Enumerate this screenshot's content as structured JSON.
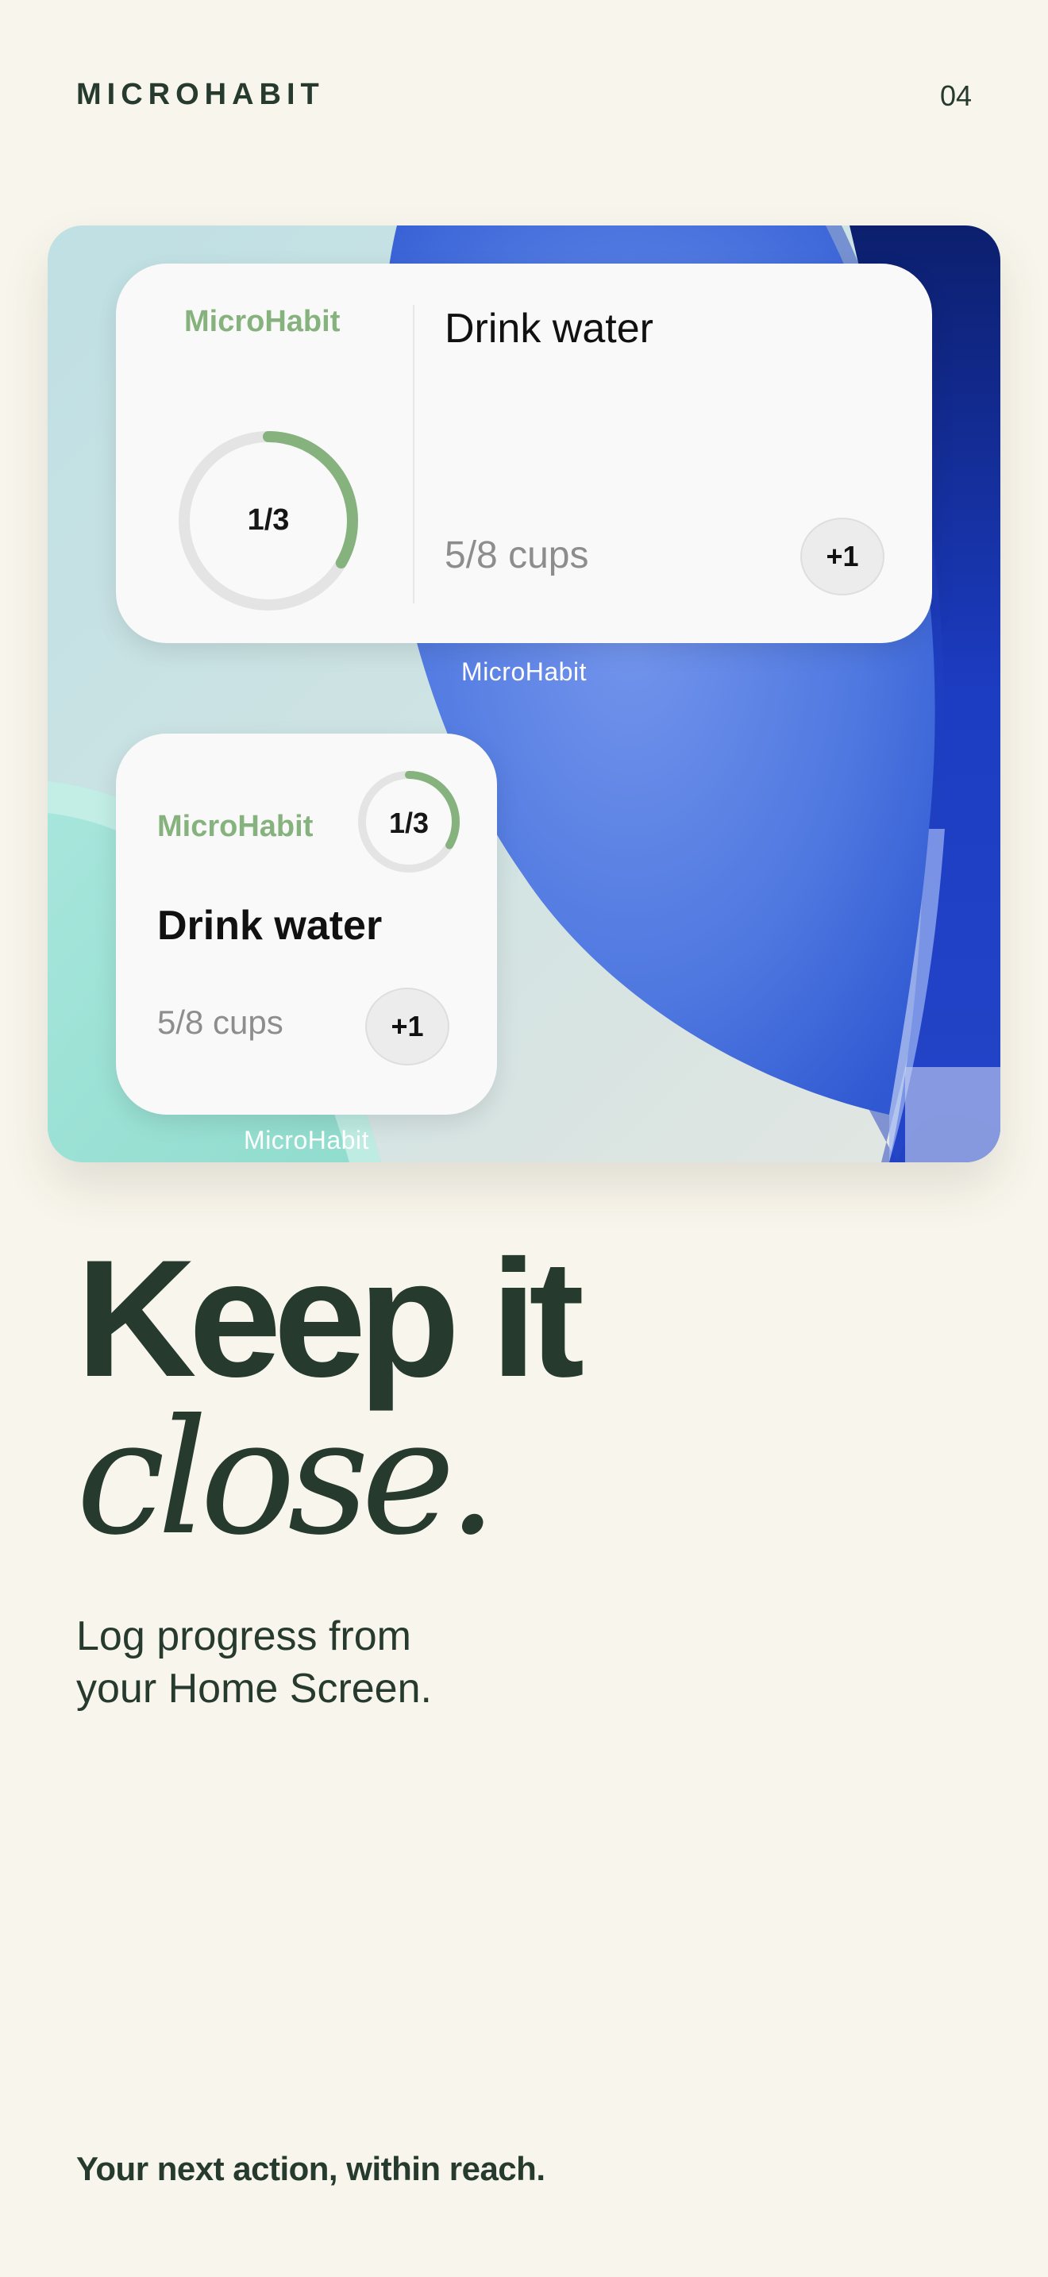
{
  "header": {
    "brand": "MICROHABIT",
    "page_number": "04"
  },
  "widgets": {
    "medium": {
      "brand": "MicroHabit",
      "progress_text": "1/3",
      "progress_fraction": 0.3333,
      "title": "Drink water",
      "cups": "5/8 cups",
      "button_label": "+1",
      "caption": "MicroHabit"
    },
    "small": {
      "brand": "MicroHabit",
      "progress_text": "1/3",
      "progress_fraction": 0.3333,
      "title": "Drink water",
      "cups": "5/8 cups",
      "button_label": "+1",
      "caption": "MicroHabit"
    }
  },
  "headline": {
    "line1": "Keep it",
    "line2": "close."
  },
  "subtitle": {
    "line1": "Log progress from",
    "line2": "your Home Screen."
  },
  "tagline": "Your next action, within reach.",
  "colors": {
    "background": "#f8f5ec",
    "text_dark": "#263a2e",
    "accent_green": "#86b27e",
    "ring_track": "#e4e4e4"
  }
}
